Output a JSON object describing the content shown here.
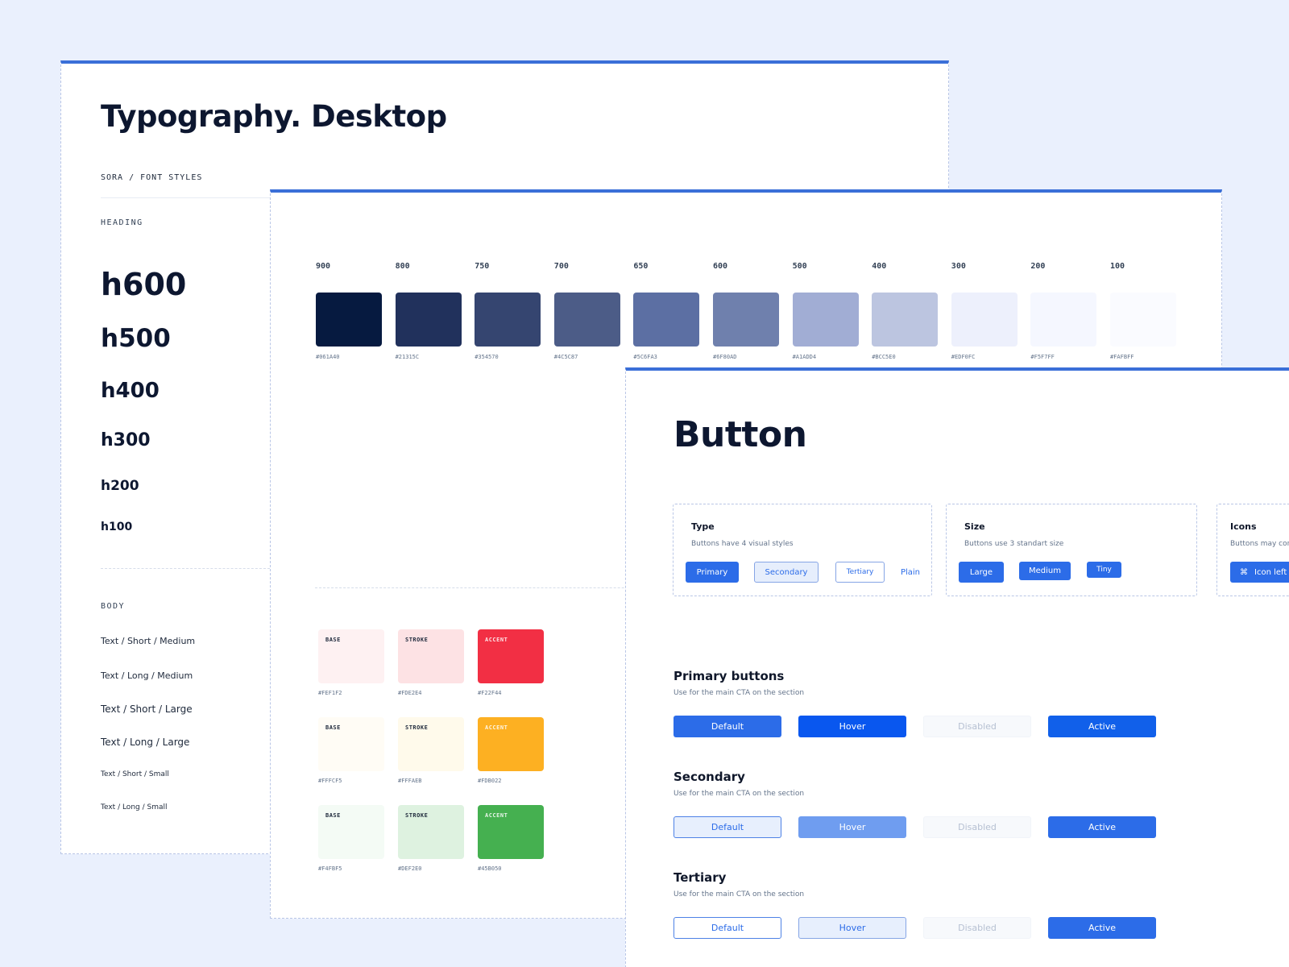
{
  "typography": {
    "title": "Typography. Desktop",
    "breadcrumb": "SORA / FONT STYLES",
    "heading_label": "HEADING",
    "headings": [
      "h600",
      "h500",
      "h400",
      "h300",
      "h200",
      "h100"
    ],
    "body_label": "BODY",
    "body_styles": [
      "Text / Short / Medium",
      "Text / Long / Medium",
      "Text / Short / Large",
      "Text / Long / Large",
      "Text / Short / Small",
      "Text / Long / Small"
    ]
  },
  "palette": {
    "shades": [
      {
        "label": "900",
        "hex": "#061A40"
      },
      {
        "label": "800",
        "hex": "#21315C"
      },
      {
        "label": "750",
        "hex": "#354570"
      },
      {
        "label": "700",
        "hex": "#4C5C87"
      },
      {
        "label": "650",
        "hex": "#5C6FA3"
      },
      {
        "label": "600",
        "hex": "#6F80AD"
      },
      {
        "label": "500",
        "hex": "#A1ADD4"
      },
      {
        "label": "400",
        "hex": "#BCC5E0"
      },
      {
        "label": "300",
        "hex": "#EDF0FC"
      },
      {
        "label": "200",
        "hex": "#F5F7FF"
      },
      {
        "label": "100",
        "hex": "#FAFBFF"
      }
    ],
    "status": [
      [
        {
          "label": "BASE",
          "hex": "#FEF1F2"
        },
        {
          "label": "STROKE",
          "hex": "#FDE2E4"
        },
        {
          "label": "ACCENT",
          "hex": "#F22F44"
        }
      ],
      [
        {
          "label": "BASE",
          "hex": "#FFFCF5"
        },
        {
          "label": "STROKE",
          "hex": "#FFFAEB"
        },
        {
          "label": "ACCENT",
          "hex": "#FDB022"
        }
      ],
      [
        {
          "label": "BASE",
          "hex": "#F4FBF5"
        },
        {
          "label": "STROKE",
          "hex": "#DEF2E0"
        },
        {
          "label": "ACCENT",
          "hex": "#45B050"
        }
      ]
    ]
  },
  "button": {
    "title": "Button",
    "cards": {
      "type": {
        "title": "Type",
        "desc": "Buttons have 4 visual styles",
        "buttons": [
          "Primary",
          "Secondary",
          "Tertiary",
          "Plain"
        ]
      },
      "size": {
        "title": "Size",
        "desc": "Buttons use 3 standart size",
        "buttons": [
          "Large",
          "Medium",
          "Tiny"
        ]
      },
      "icons": {
        "title": "Icons",
        "desc": "Buttons may con",
        "button": "Icon left"
      }
    },
    "groups": [
      {
        "title": "Primary buttons",
        "desc": "Use for the main CTA on the section",
        "states": [
          "Default",
          "Hover",
          "Disabled",
          "Active"
        ]
      },
      {
        "title": "Secondary",
        "desc": "Use for the main CTA on the section",
        "states": [
          "Default",
          "Hover",
          "Disabled",
          "Active"
        ]
      },
      {
        "title": "Tertiary",
        "desc": "Use for the main CTA on the section",
        "states": [
          "Default",
          "Hover",
          "Disabled",
          "Active"
        ]
      }
    ]
  }
}
